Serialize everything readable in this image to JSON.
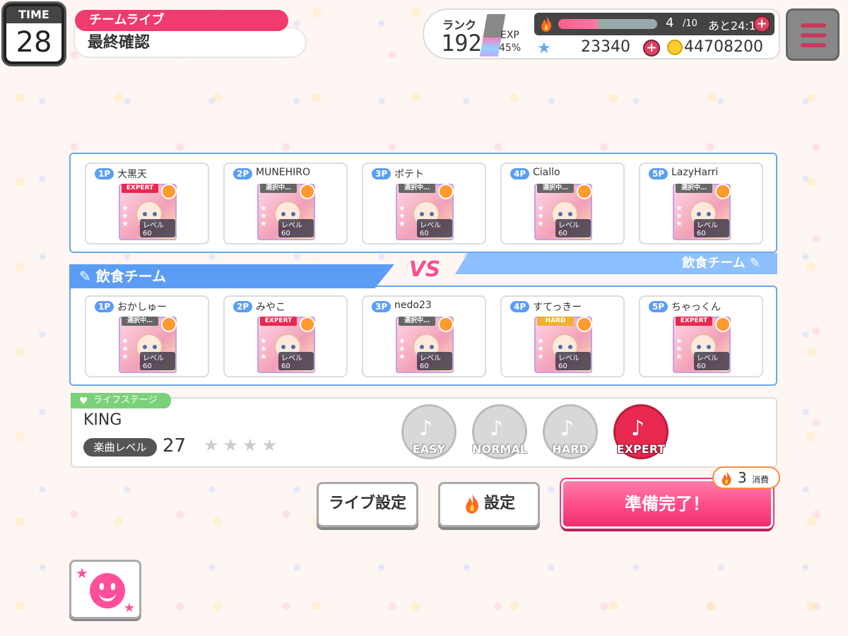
{
  "time": {
    "label": "TIME",
    "value": "28"
  },
  "header": {
    "mode": "チームライブ",
    "screen_title": "最終確認"
  },
  "status": {
    "rank_label": "ランク",
    "rank": "192",
    "exp_label": "EXP",
    "exp_percent": "45%",
    "exp_progress": 0.45,
    "stamina_current": "4",
    "stamina_max": "/10",
    "stamina_progress": 0.4,
    "stamina_recovery": "あと24:14",
    "stars": "23340",
    "coins": "44708200",
    "plus_label": "+"
  },
  "teams": {
    "top": {
      "players": [
        {
          "slot": "1P",
          "name": "大黒天",
          "difficulty": "EXPERT",
          "level": "レベル60"
        },
        {
          "slot": "2P",
          "name": "MUNEHIRO",
          "difficulty": "選択中…",
          "level": "レベル60"
        },
        {
          "slot": "3P",
          "name": "ポテト",
          "difficulty": "選択中…",
          "level": "レベル60"
        },
        {
          "slot": "4P",
          "name": "Ciallo",
          "difficulty": "選択中…",
          "level": "レベル60"
        },
        {
          "slot": "5P",
          "name": "LazyHarri",
          "difficulty": "選択中…",
          "level": "レベル60"
        }
      ]
    },
    "vs_label": "VS",
    "left_team_name": "飲食チーム",
    "right_team_name": "飲食チーム",
    "bottom": {
      "players": [
        {
          "slot": "1P",
          "name": "おかしゅー",
          "difficulty": "選択中…",
          "level": "レベル60"
        },
        {
          "slot": "2P",
          "name": "みやこ",
          "difficulty": "EXPERT",
          "level": "レベル60"
        },
        {
          "slot": "3P",
          "name": "nedo23",
          "difficulty": "選択中…",
          "level": "レベル60"
        },
        {
          "slot": "4P",
          "name": "すてっきー",
          "difficulty": "HARD",
          "level": "レベル60"
        },
        {
          "slot": "5P",
          "name": "ちゃっくん",
          "difficulty": "EXPERT",
          "level": "レベル60"
        }
      ]
    }
  },
  "stage": {
    "tag": "ライフステージ",
    "song": "KING",
    "level_label": "楽曲レベル",
    "level": "27",
    "stars": "★★★★",
    "difficulties": [
      "EASY",
      "NORMAL",
      "HARD",
      "EXPERT"
    ],
    "selected_difficulty": "EXPERT"
  },
  "buttons": {
    "live_settings": "ライブ設定",
    "settings": "設定",
    "ready": "準備完了！",
    "cost": "3",
    "cost_label": "消費"
  },
  "colors": {
    "accent": "#ef3b6e",
    "team_blue": "#5b9df5",
    "expert": "#e8284f",
    "hard": "#f0b030",
    "stage_green": "#7ad17a"
  }
}
